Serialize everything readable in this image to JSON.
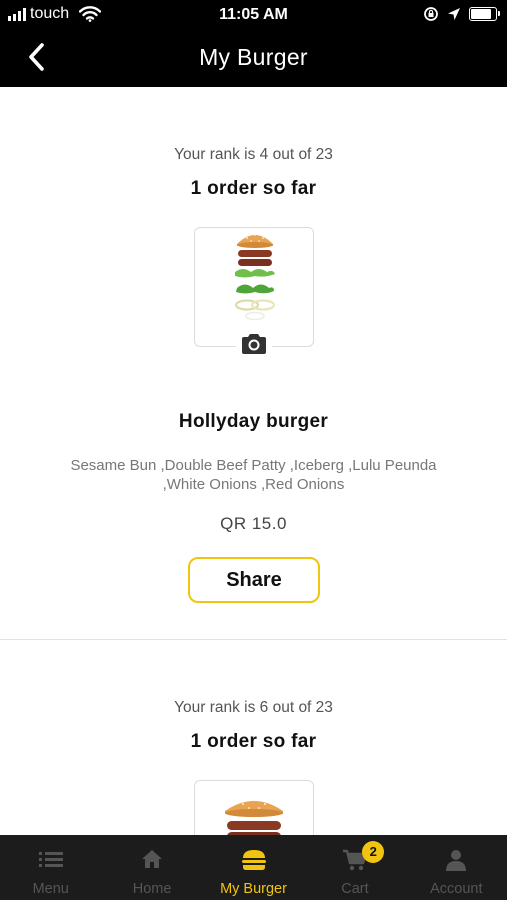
{
  "status_bar": {
    "carrier": "touch",
    "time": "11:05 AM",
    "battery_level": 0.85
  },
  "nav": {
    "title": "My Burger",
    "back_icon": "chevron-left-icon"
  },
  "cards": [
    {
      "rank_text": "Your rank is 4 out of 23",
      "orders_text": "1 order so far",
      "name": "Hollyday burger",
      "ingredients": "Sesame Bun ,Double Beef Patty ,Iceberg ,Lulu Peunda ,White Onions ,Red Onions",
      "price": "QR  15.0",
      "share_label": "Share"
    },
    {
      "rank_text": "Your rank is 6 out of 23",
      "orders_text": "1 order so far"
    }
  ],
  "tabs": [
    {
      "label": "Menu",
      "icon": "list-icon",
      "active": false
    },
    {
      "label": "Home",
      "icon": "home-icon",
      "active": false
    },
    {
      "label": "My Burger",
      "icon": "burger-icon",
      "active": true
    },
    {
      "label": "Cart",
      "icon": "cart-icon",
      "active": false,
      "badge": "2"
    },
    {
      "label": "Account",
      "icon": "user-icon",
      "active": false
    }
  ],
  "colors": {
    "accent": "#f1c40f",
    "bar_background": "#000000",
    "tab_background": "#1c1c1c",
    "inactive_tab": "#555555"
  }
}
